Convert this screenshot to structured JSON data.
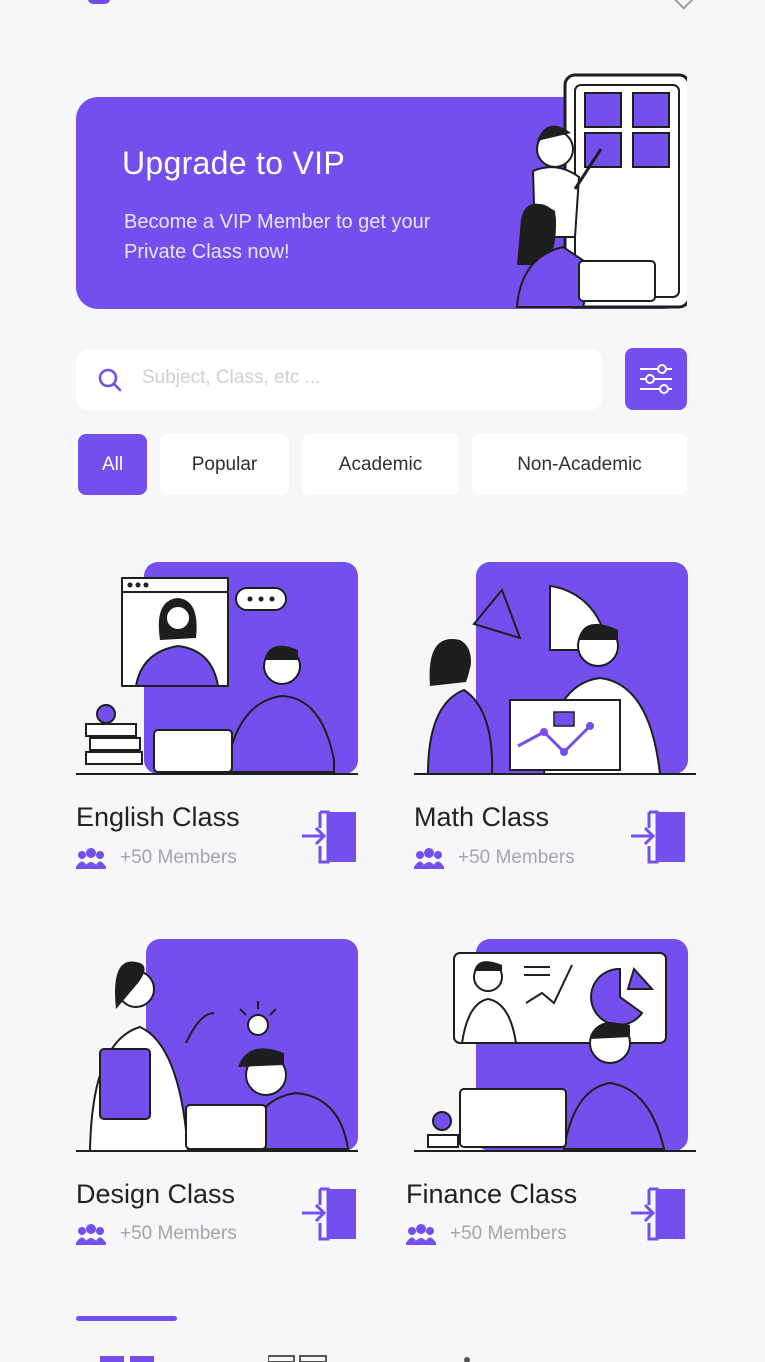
{
  "banner": {
    "title": "Upgrade to VIP",
    "subtitle": "Become a VIP Member to get your Private Class now!"
  },
  "search": {
    "placeholder": "Subject, Class, etc ..."
  },
  "filters": {
    "chips": [
      {
        "label": "All",
        "active": true
      },
      {
        "label": "Popular",
        "active": false
      },
      {
        "label": "Academic",
        "active": false
      },
      {
        "label": "Non-Academic",
        "active": false
      }
    ]
  },
  "classes": [
    {
      "title": "English Class",
      "members": "+50 Members"
    },
    {
      "title": "Math Class",
      "members": "+50 Members"
    },
    {
      "title": "Design Class",
      "members": "+50 Members"
    },
    {
      "title": "Finance Class",
      "members": "+50 Members"
    }
  ],
  "colors": {
    "accent": "#7350EE",
    "background": "#F7F7FA",
    "muted_text": "#A4A4AE"
  },
  "icons": [
    "search-icon",
    "filter-sliders-icon",
    "members-icon",
    "enter-class-icon"
  ]
}
